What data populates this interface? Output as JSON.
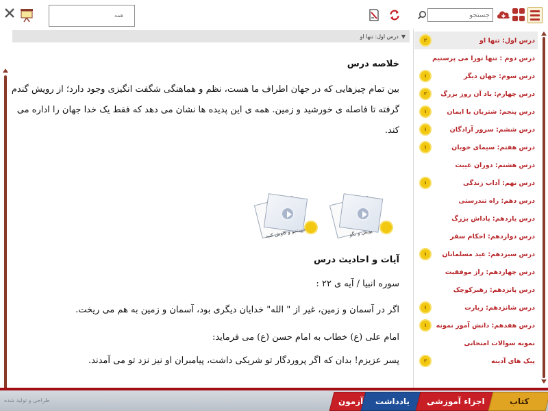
{
  "toolbar": {
    "search_placeholder": "جستجو",
    "filter_label": "همه"
  },
  "breadcrumb": "درس اول: تنها او",
  "summary": {
    "title": "خلاصه درس",
    "text": "بین تمام چیزهایی که در جهان اطراف ما هست، نظم و هماهنگی شگفت انگیزی وجود دارد؛ از رویش گندم گرفته تا فاصله ی خورشید و زمین. همه ی این پدیده ها نشان می دهد که فقط یک خدا جهان را اداره می کند."
  },
  "media": [
    {
      "caption": "پویش و بگو"
    },
    {
      "caption": "جستجو و کاوش کنید"
    }
  ],
  "verses": {
    "title": "آیات و احادیث درس",
    "reference": "سوره انبیا / آیه ی ۲۲ :",
    "verse_text": "اگر در آسمان و زمین، غیر از \" الله\" خدایان دیگری بود، آسمان و زمین به هم می ریخت.",
    "hadith_intro": "امام علی (ع) خطاب به امام حسن (ع) می فرماید:",
    "hadith_text": "پسر عزیزم! بدان که اگر پروردگار تو شریکی داشت، پیامبران او نیز نزد تو می آمدند."
  },
  "lessons": [
    {
      "title": "درس اول: تنها او",
      "badge": "۲",
      "active": true
    },
    {
      "title": "درس دوم : تنها تورا می پرستیم",
      "badge": ""
    },
    {
      "title": "درس سوم: جهان دیگر",
      "badge": "۱"
    },
    {
      "title": "درس چهارم: یاد آن روز بزرگ",
      "badge": "۲"
    },
    {
      "title": "درس پنجم: شتربان با ایمان",
      "badge": "۱"
    },
    {
      "title": "درس ششم: سرور آزادگان",
      "badge": "۱"
    },
    {
      "title": "درس هفتم: سیمای خوبان",
      "badge": "۱"
    },
    {
      "title": "درس هشتم: دوران غیبت",
      "badge": ""
    },
    {
      "title": "درس نهم: آداب زندگی",
      "badge": "۱"
    },
    {
      "title": "درس دهم: راه تندرستی",
      "badge": ""
    },
    {
      "title": "درس یازدهم: پاداش بزرگ",
      "badge": ""
    },
    {
      "title": "درس دوازدهم: احکام سفر",
      "badge": ""
    },
    {
      "title": "درس سیزدهم: عید مسلمانان",
      "badge": "۱"
    },
    {
      "title": "درس چهاردهم: راز موفقیت",
      "badge": ""
    },
    {
      "title": "درس پانزدهم: رهبرکوچک",
      "badge": ""
    },
    {
      "title": "درس شانزدهم: زیارت",
      "badge": "۱"
    },
    {
      "title": "درس هفدهم: دانش آموز نمونه",
      "badge": "۱"
    },
    {
      "title": "نمونه سوالات امتحانی",
      "badge": ""
    },
    {
      "title": "پیک های آدینه",
      "badge": "۲"
    }
  ],
  "bottom_tabs": {
    "book": "کتاب",
    "parts": "اجزاء آموزشی",
    "notes": "یادداشت",
    "exam": "آزمون"
  },
  "bottom_faint": "طراحی و تولید شده",
  "colors": {
    "accent_red": "#c81e25",
    "lesson_text": "#b8262a",
    "gold": "#e0a422",
    "notes_blue": "#204f9a"
  }
}
